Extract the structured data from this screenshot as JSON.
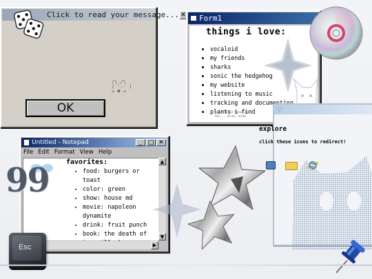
{
  "message_window": {
    "title": "Click to read your message...",
    "button_label": "OK",
    "face_art": "/\\_/\\\n( ·.· )\n> ♥ <"
  },
  "form1": {
    "title": "Form1",
    "heading": "things i love:",
    "items": [
      "vocaloid",
      "my friends",
      "sharks",
      "sonic the hedgehog",
      "my website",
      "listening to music",
      "tracking and documenting",
      "plants i find"
    ],
    "note": "you should know about the... blah, blah"
  },
  "notepad": {
    "title": "Untitled - Notepad",
    "menu": [
      "File",
      "Edit",
      "Format",
      "View",
      "Help"
    ],
    "heading": "favorites:",
    "items": [
      "food: burgers or toast",
      "color: green",
      "show: house md",
      "movie: napoleon dynamite",
      "drink: fruit punch",
      "book: the death of ivan illych"
    ]
  },
  "explore": {
    "title": "explore",
    "subtitle": "click these icons to redirect!",
    "window_icon": "heart-icon"
  },
  "decor": {
    "esc_key": "Esc",
    "swirl_text": "99"
  },
  "colors": {
    "title_blue": "#0a246a",
    "title_blue_light": "#a6caf0",
    "desktop": "#eceef2",
    "accent_pink": "#e14b8a"
  }
}
